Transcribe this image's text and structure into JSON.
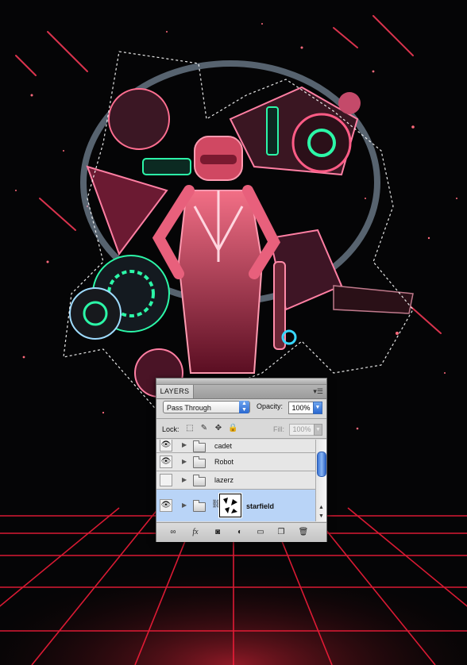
{
  "layers_panel": {
    "tab_label": "LAYERS",
    "menu_icon": "panel-menu-icon",
    "blend_mode": "Pass Through",
    "opacity_label": "Opacity:",
    "opacity_value": "100%",
    "lock_label": "Lock:",
    "fill_label": "Fill:",
    "fill_value": "100%",
    "layers": [
      {
        "name": "cadet",
        "visible": true,
        "type": "group"
      },
      {
        "name": "Robot",
        "visible": true,
        "type": "group"
      },
      {
        "name": "lazerz",
        "visible": false,
        "type": "group"
      },
      {
        "name": "starfield",
        "visible": true,
        "type": "group",
        "has_mask": true,
        "selected": true
      }
    ],
    "bottom_icons": [
      "link-layers-icon",
      "fx-icon",
      "add-mask-icon",
      "adjustment-layer-icon",
      "new-group-icon",
      "new-layer-icon",
      "delete-layer-icon"
    ]
  },
  "colors": {
    "background": "#000000",
    "grid": "#ff1e3c",
    "accent_pink": "#ff3c78",
    "accent_green": "#2cf7a8",
    "panel_gray": "#d9d9d9",
    "selection_blue": "#b9d4f7"
  }
}
